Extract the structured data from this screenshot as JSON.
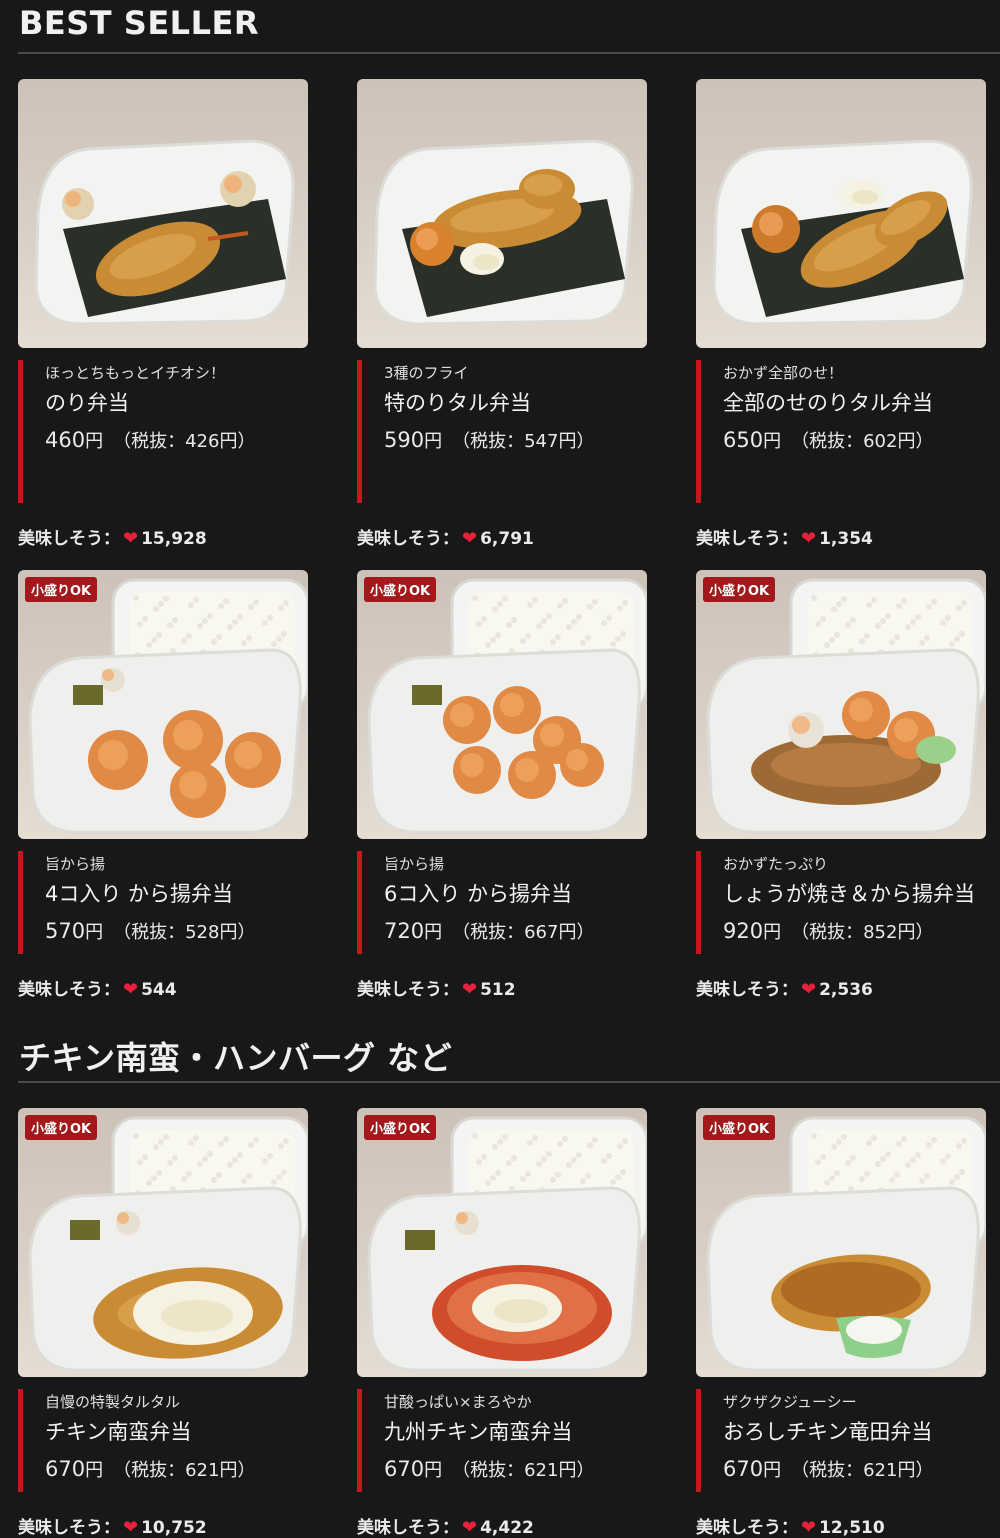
{
  "sections": [
    {
      "title": "BEST SELLER"
    },
    {
      "title": "チキン南蛮・ハンバーグ など"
    }
  ],
  "labels": {
    "likes_label": "美味しそう：",
    "tax_prefix": "（税抜：",
    "tax_suffix": "円）",
    "yen": "円"
  },
  "colors": {
    "accent": "#c01a1f",
    "heart": "#e8203a",
    "background": "#181818"
  },
  "icons": {
    "heart": "heart-icon"
  },
  "products": [
    {
      "badge": "",
      "catch": "ほっとちもっとイチオシ！",
      "name": "のり弁当",
      "price": "460",
      "price_ex": "426",
      "likes": "15,928"
    },
    {
      "badge": "",
      "catch": "3種のフライ",
      "name": "特のりタル弁当",
      "price": "590",
      "price_ex": "547",
      "likes": "6,791"
    },
    {
      "badge": "",
      "catch": "おかず全部のせ！",
      "name": "全部のせのりタル弁当",
      "price": "650",
      "price_ex": "602",
      "likes": "1,354"
    },
    {
      "badge": "小盛りOK",
      "catch": "旨から揚",
      "name": "4コ入り から揚弁当",
      "price": "570",
      "price_ex": "528",
      "likes": "544"
    },
    {
      "badge": "小盛りOK",
      "catch": "旨から揚",
      "name": "6コ入り から揚弁当",
      "price": "720",
      "price_ex": "667",
      "likes": "512"
    },
    {
      "badge": "小盛りOK",
      "catch": "おかずたっぷり",
      "name": "しょうが焼き＆から揚弁当",
      "price": "920",
      "price_ex": "852",
      "likes": "2,536"
    },
    {
      "badge": "小盛りOK",
      "catch": "自慢の特製タルタル",
      "name": "チキン南蛮弁当",
      "price": "670",
      "price_ex": "621",
      "likes": "10,752"
    },
    {
      "badge": "小盛りOK",
      "catch": "甘酸っぱい×まろやか",
      "name": "九州チキン南蛮弁当",
      "price": "670",
      "price_ex": "621",
      "likes": "4,422"
    },
    {
      "badge": "小盛りOK",
      "catch": "ザクザクジューシー",
      "name": "おろしチキン竜田弁当",
      "price": "670",
      "price_ex": "621",
      "likes": "12,510"
    }
  ]
}
